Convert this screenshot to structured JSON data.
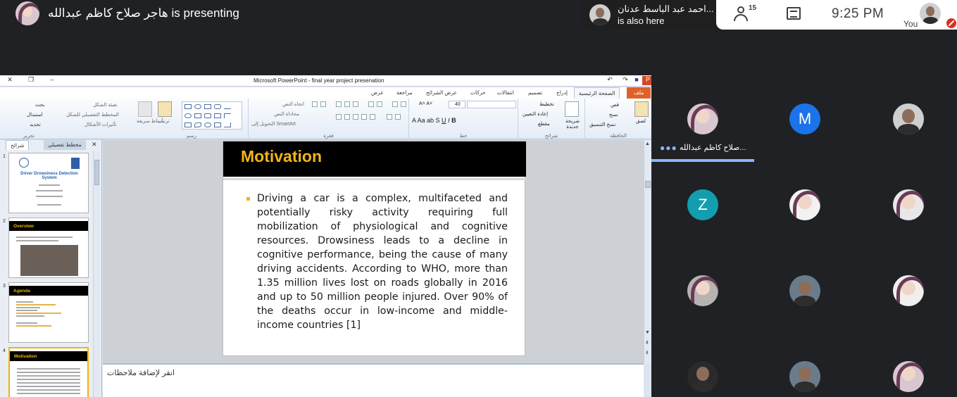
{
  "meet": {
    "presenter_text": "هاجر صلاح كاظم عبدالله is presenting",
    "notification": {
      "name": "احمد عبد الباسط عدنان...",
      "status": "is also here"
    },
    "participant_count": "15",
    "time": "9:25 PM",
    "you_label": "You",
    "active_speaker_name": "صلاح كاظم عبدالله...",
    "participants": [
      {
        "type": "photo"
      },
      {
        "type": "letter",
        "letter": "M",
        "color": "#1a73e8"
      },
      {
        "type": "photo"
      },
      {
        "type": "letter",
        "letter": "Z",
        "color": "#129eaf"
      },
      {
        "type": "photo"
      },
      {
        "type": "photo"
      },
      {
        "type": "photo"
      },
      {
        "type": "photo"
      },
      {
        "type": "photo"
      },
      {
        "type": "photo"
      },
      {
        "type": "photo"
      },
      {
        "type": "photo"
      }
    ]
  },
  "powerpoint": {
    "window_title": "Microsoft PowerPoint - final year project presenation",
    "tabs": [
      "ملف",
      "الصفحة الرئيسية",
      "إدراج",
      "تصميم",
      "انتقالات",
      "حركات",
      "عرض الشرائح",
      "مراجعة",
      "عرض"
    ],
    "ribbon": {
      "clipboard": {
        "label": "الحافظة",
        "paste": "لصق",
        "cut": "قص",
        "copy": "نسخ",
        "format": "نسخ التنسيق"
      },
      "slides": {
        "label": "شرائح",
        "new": "شريحة جديدة",
        "layout": "تخطيط",
        "reset": "إعادة التعيين",
        "section": "مقطع"
      },
      "font": {
        "label": "خط",
        "size": "40"
      },
      "paragraph": {
        "label": "فقرة",
        "direction": "اتجاه النص",
        "align": "محاذاة النص",
        "smartart": "التحويل إلى SmartArt"
      },
      "drawing": {
        "label": "رسم",
        "arrange": "ترتيب",
        "quick_styles": "أنماط سريعة"
      },
      "shape_fmt": {
        "fill": "تعبئة الشكل",
        "outline": "المخطط التفصيلي للشكل",
        "effects": "تأثيرات الأشكال"
      },
      "editing": {
        "label": "تحرير",
        "find": "بحث",
        "replace": "استبدال",
        "select": "تحديد"
      }
    },
    "side_tabs": {
      "slides": "شرائح",
      "outline": "مخطط تفصيلي"
    },
    "thumbnails": [
      {
        "num": "1",
        "title": "Driver Drowsiness Detection System"
      },
      {
        "num": "2",
        "title": "Overview"
      },
      {
        "num": "3",
        "title": "Agenda"
      },
      {
        "num": "4",
        "title": "Motivation"
      }
    ],
    "slide": {
      "title": "Motivation",
      "body": "Driving a car is a complex, multifaceted and potentially risky activity requiring full mobilization of physiological and cognitive resources. Drowsiness leads to a decline in cognitive performance, being the cause of many driving accidents. According to WHO, more than 1.35 million lives lost on roads globally in 2016 and up to 50 million people injured. Over 90% of the deaths occur in low-income and middle-income countries [1]"
    },
    "notes_placeholder": "انقر لإضافة ملاحظات"
  }
}
